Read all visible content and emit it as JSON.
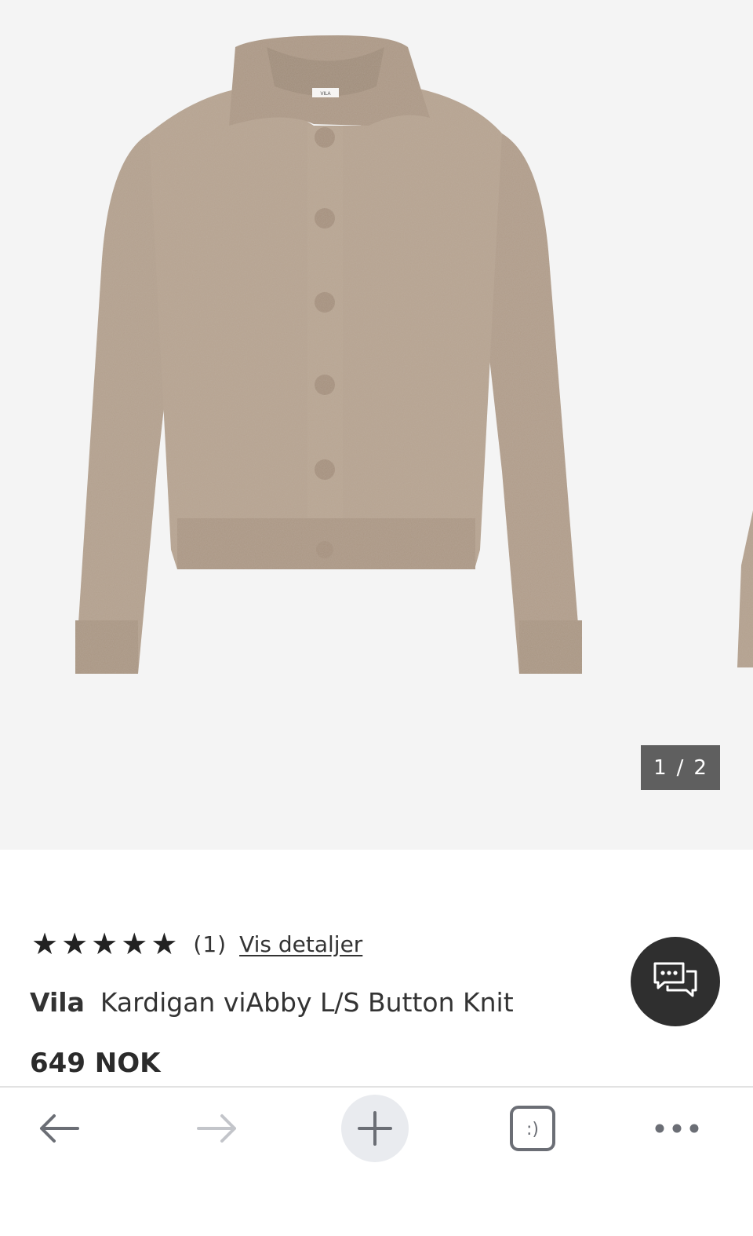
{
  "gallery": {
    "current_index": "1",
    "separator": "/",
    "total": "2"
  },
  "rating": {
    "stars_filled": 5,
    "stars_total": 5,
    "review_count": "(1)",
    "details_link": "Vis detaljer"
  },
  "product": {
    "brand": "Vila",
    "name": "Kardigan viAbby L/S Button Knit",
    "price": "649 NOK",
    "label_text": "VILA"
  },
  "chat": {
    "icon": "chat-bubbles-icon"
  },
  "toolbar": {
    "back_icon": "arrow-left-icon",
    "forward_icon": "arrow-right-icon",
    "new_tab_icon": "plus-icon",
    "tabs_icon": "tabs-icon",
    "tabs_label": ":)",
    "more_icon": "more-dots-icon"
  },
  "colors": {
    "knit": "#b09d8a",
    "gallery_bg": "#f4f4f4",
    "counter_bg": "#5f5f5f",
    "chat_bg": "#2f2f2f",
    "new_tab_bg": "#e9ebef"
  }
}
